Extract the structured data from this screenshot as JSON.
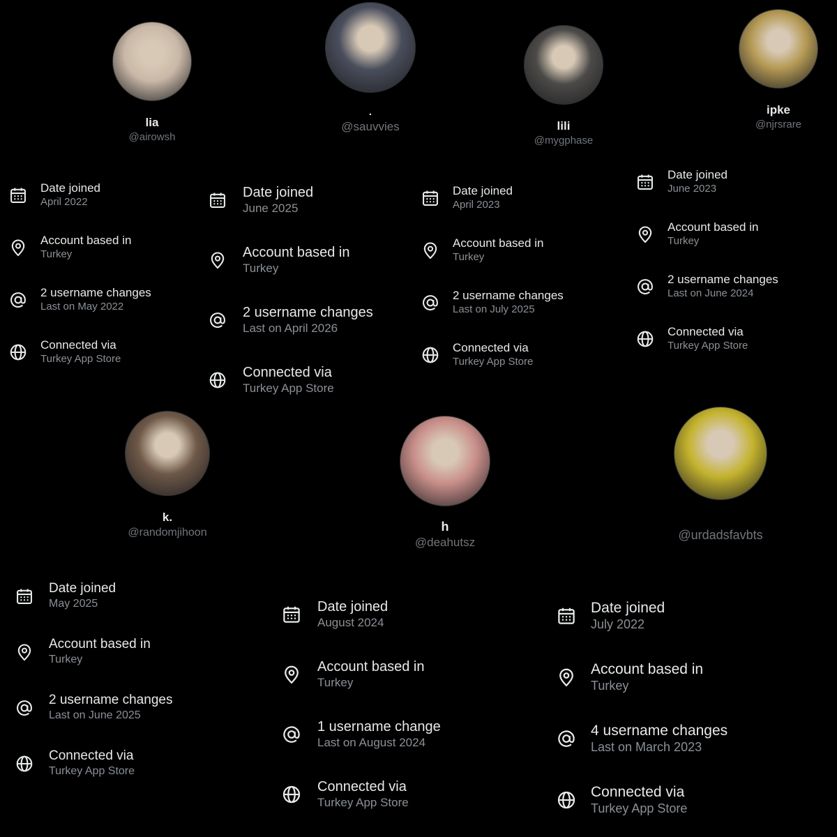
{
  "profiles": [
    {
      "name": "lia",
      "handle": "@airowsh",
      "avatar_color": "#c9b8a7",
      "avatar_icon": "avatar-photo"
    },
    {
      "name": ".",
      "handle": "@sauvvies",
      "avatar_color": "#4a4e5c",
      "avatar_icon": "avatar-photo"
    },
    {
      "name": "lili",
      "handle": "@mygphase",
      "avatar_color": "#4b4a48",
      "avatar_icon": "avatar-photo"
    },
    {
      "name": "ipke",
      "handle": "@njrsrare",
      "avatar_color": "#b59a55",
      "avatar_icon": "avatar-photo"
    },
    {
      "name": "k.",
      "handle": "@randomjihoon",
      "avatar_color": "#6e5848",
      "avatar_icon": "avatar-photo"
    },
    {
      "name": "h",
      "handle": "@deahutsz",
      "avatar_color": "#c98f8a",
      "avatar_icon": "avatar-photo"
    },
    {
      "name": "",
      "handle": "@urdadsfavbts",
      "avatar_color": "#c4b32e",
      "avatar_icon": "avatar-photo"
    }
  ],
  "infos": [
    {
      "date_label": "Date joined",
      "date": "April 2022",
      "location_label": "Account based in",
      "location": "Turkey",
      "username_label": "2 username changes",
      "username_last": "Last on May 2022",
      "connected_label": "Connected via",
      "connected": "Turkey App Store"
    },
    {
      "date_label": "Date joined",
      "date": "June 2025",
      "location_label": "Account based in",
      "location": "Turkey",
      "username_label": "2 username changes",
      "username_last": "Last on April 2026",
      "connected_label": "Connected via",
      "connected": "Turkey App Store"
    },
    {
      "date_label": "Date joined",
      "date": "April 2023",
      "location_label": "Account based in",
      "location": "Turkey",
      "username_label": "2 username changes",
      "username_last": "Last on July 2025",
      "connected_label": "Connected via",
      "connected": "Turkey App Store"
    },
    {
      "date_label": "Date joined",
      "date": "June 2023",
      "location_label": "Account based in",
      "location": "Turkey",
      "username_label": "2 username changes",
      "username_last": "Last on June 2024",
      "connected_label": "Connected via",
      "connected": "Turkey App Store"
    },
    {
      "date_label": "Date joined",
      "date": "May 2025",
      "location_label": "Account based in",
      "location": "Turkey",
      "username_label": "2 username changes",
      "username_last": "Last on June 2025",
      "connected_label": "Connected via",
      "connected": "Turkey App Store"
    },
    {
      "date_label": "Date joined",
      "date": "August 2024",
      "location_label": "Account based in",
      "location": "Turkey",
      "username_label": "1 username change",
      "username_last": "Last on August 2024",
      "connected_label": "Connected via",
      "connected": "Turkey App Store"
    },
    {
      "date_label": "Date joined",
      "date": "July 2022",
      "location_label": "Account based in",
      "location": "Turkey",
      "username_label": "4 username changes",
      "username_last": "Last on March 2023",
      "connected_label": "Connected via",
      "connected": "Turkey App Store"
    }
  ],
  "icons": {
    "date": "calendar-icon",
    "location": "location-pin-icon",
    "username": "at-sign-icon",
    "connected": "globe-icon"
  }
}
